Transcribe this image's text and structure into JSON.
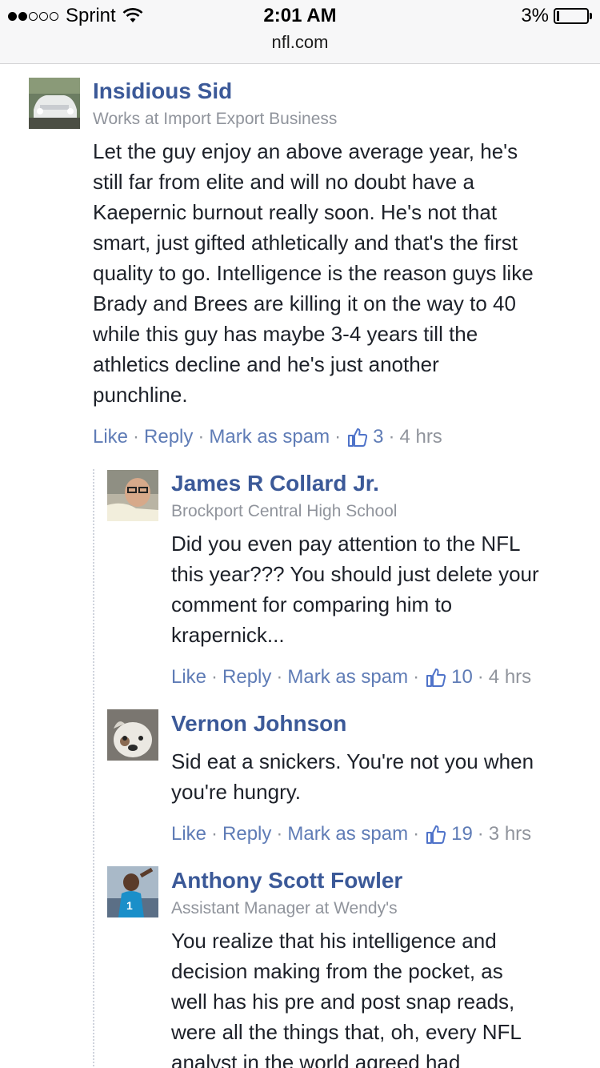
{
  "status_bar": {
    "carrier": "Sprint",
    "time": "2:01 AM",
    "battery": "3%",
    "url": "nfl.com"
  },
  "comments": [
    {
      "name": "Insidious Sid",
      "subtitle": "Works at Import Export Business",
      "lines": [
        "Let the guy enjoy an above average year, he's",
        "still far from elite and will no doubt have a",
        "Kaepernic burnout really soon. He's not that",
        "smart, just gifted athletically and that's the first",
        "quality to go. Intelligence is the reason guys like",
        "Brady and Brees are killing it on the way to 40",
        "while this guy has maybe 3-4 years till the",
        "athletics decline and he's just another",
        "punchline."
      ],
      "like": "Like",
      "reply": "Reply",
      "spam": "Mark as spam",
      "likes": "3",
      "time": "4 hrs"
    },
    {
      "name": "James R Collard Jr.",
      "subtitle": "Brockport Central High School",
      "lines": [
        "Did you even pay attention to the NFL",
        "this year??? You should just delete your",
        "comment for comparing him to",
        "krapernick..."
      ],
      "like": "Like",
      "reply": "Reply",
      "spam": "Mark as spam",
      "likes": "10",
      "time": "4 hrs"
    },
    {
      "name": "Vernon Johnson",
      "subtitle": "",
      "lines": [
        "Sid eat a snickers. You're not you when",
        "you're hungry."
      ],
      "like": "Like",
      "reply": "Reply",
      "spam": "Mark as spam",
      "likes": "19",
      "time": "3 hrs"
    },
    {
      "name": "Anthony Scott Fowler",
      "subtitle": "Assistant Manager at Wendy's",
      "lines": [
        "You realize that his intelligence and",
        "decision making from the pocket, as",
        "well has his pre and post snap reads,",
        "were all the things that, oh, every NFL",
        "analyst in the world agreed had"
      ]
    }
  ]
}
